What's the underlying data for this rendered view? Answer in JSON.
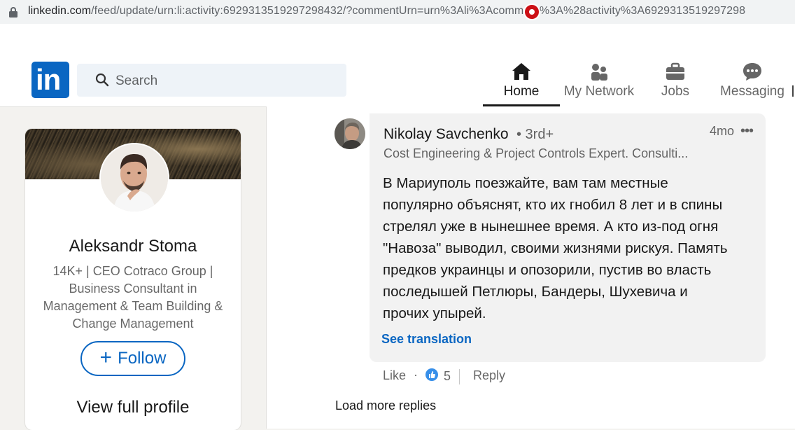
{
  "browser": {
    "url_host": "linkedin.com",
    "url_path": "/feed/update/urn:li:activity:6929313519297298432/?commentUrn=urn%3Ali%3Acomment%3A%28activity%3A6929313519297298"
  },
  "nav": {
    "search_placeholder": "Search",
    "items": [
      {
        "label": "Home",
        "icon": "home-icon",
        "active": true
      },
      {
        "label": "My Network",
        "icon": "people-icon"
      },
      {
        "label": "Jobs",
        "icon": "briefcase-icon"
      },
      {
        "label": "Messaging",
        "icon": "chat-icon"
      }
    ]
  },
  "profile": {
    "name": "Aleksandr Stoma",
    "headline": "14K+ | CEO Cotraco Group | Business Consultant in Management & Team Building & Change Management",
    "follow_label": "Follow",
    "view_profile_label": "View full profile"
  },
  "comment": {
    "author": "Nikolay Savchenko",
    "degree": "• 3rd+",
    "time": "4mo",
    "more": "•••",
    "headline": "Cost Engineering & Project Controls Expert. Consulti...",
    "text_lines": [
      "В Мариуполь поезжайте, вам там местные",
      "популярно объяснят, кто их гнобил 8 лет и в спины",
      "стрелял уже в нынешнее время. А кто из-под огня",
      "\"Навоза\" выводил, своими жизнями рискуя. Память",
      "предков украинцы и опозорили, пустив во власть",
      "последышей Петлюры, Бандеры, Шухевича и",
      "прочих упырей."
    ],
    "see_translation": "See translation",
    "like_label": "Like",
    "dot": "·",
    "reaction_count": "5",
    "reply_label": "Reply"
  },
  "load_more": "Load more replies",
  "colors": {
    "brand": "#0a66c2",
    "notification": "#cc1016",
    "page_bg": "#f3f2ef"
  }
}
